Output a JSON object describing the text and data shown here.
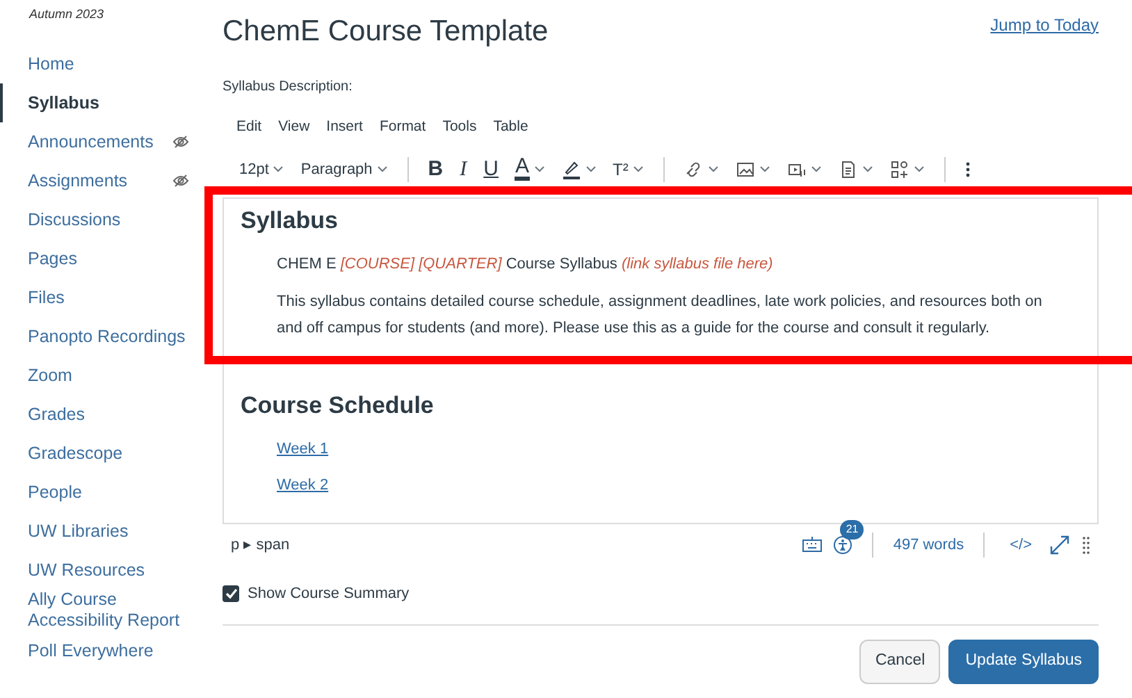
{
  "sidebar": {
    "term": "Autumn 2023",
    "items": [
      {
        "label": "Home",
        "selected": false,
        "hidden": false
      },
      {
        "label": "Syllabus",
        "selected": true,
        "hidden": false
      },
      {
        "label": "Announcements",
        "selected": false,
        "hidden": true
      },
      {
        "label": "Assignments",
        "selected": false,
        "hidden": true
      },
      {
        "label": "Discussions",
        "selected": false,
        "hidden": false
      },
      {
        "label": "Pages",
        "selected": false,
        "hidden": false
      },
      {
        "label": "Files",
        "selected": false,
        "hidden": false
      },
      {
        "label": "Panopto Recordings",
        "selected": false,
        "hidden": false
      },
      {
        "label": "Zoom",
        "selected": false,
        "hidden": false
      },
      {
        "label": "Grades",
        "selected": false,
        "hidden": false
      },
      {
        "label": "Gradescope",
        "selected": false,
        "hidden": false
      },
      {
        "label": "People",
        "selected": false,
        "hidden": false
      },
      {
        "label": "UW Libraries",
        "selected": false,
        "hidden": false
      },
      {
        "label": "UW Resources",
        "selected": false,
        "hidden": false
      },
      {
        "label": "Ally Course Accessibility Report",
        "selected": false,
        "hidden": false
      },
      {
        "label": "Poll Everywhere",
        "selected": false,
        "hidden": false
      }
    ]
  },
  "header": {
    "title": "ChemE Course Template",
    "jump_link": "Jump to Today"
  },
  "editor": {
    "label": "Syllabus Description:",
    "menus": [
      "Edit",
      "View",
      "Insert",
      "Format",
      "Tools",
      "Table"
    ],
    "font_size": "12pt",
    "block_format": "Paragraph",
    "format_buttons": [
      {
        "label": "B",
        "kind": "bold"
      },
      {
        "label": "I",
        "kind": "italic"
      },
      {
        "label": "U",
        "kind": "underline"
      },
      {
        "label": "A",
        "kind": "color"
      },
      {
        "label": "T²",
        "kind": "superscript"
      }
    ],
    "content": [
      {
        "kind": "heading",
        "text": "Syllabus"
      },
      {
        "kind": "para",
        "text": "CHEM E *[COURSE] [QUARTER]* Course Syllabus *(link syllabus file here)*"
      },
      {
        "kind": "para",
        "text": "This syllabus contains detailed course schedule, assignment deadlines, late work policies, and resources both on and off campus for students (and more). Please use this as a guide for the course and consult it regularly."
      },
      {
        "kind": "heading",
        "text": "Course Schedule"
      },
      {
        "kind": "link",
        "text": "Week 1"
      },
      {
        "kind": "link",
        "text": "Week 2"
      }
    ],
    "path": "p ▸ span",
    "a11y_count": "21",
    "word_count": "497 words",
    "html_toggle": "</>"
  },
  "show_summary": {
    "label": "Show Course Summary",
    "checked": true
  },
  "buttons": {
    "cancel": "Cancel",
    "submit": "Update Syllabus"
  }
}
